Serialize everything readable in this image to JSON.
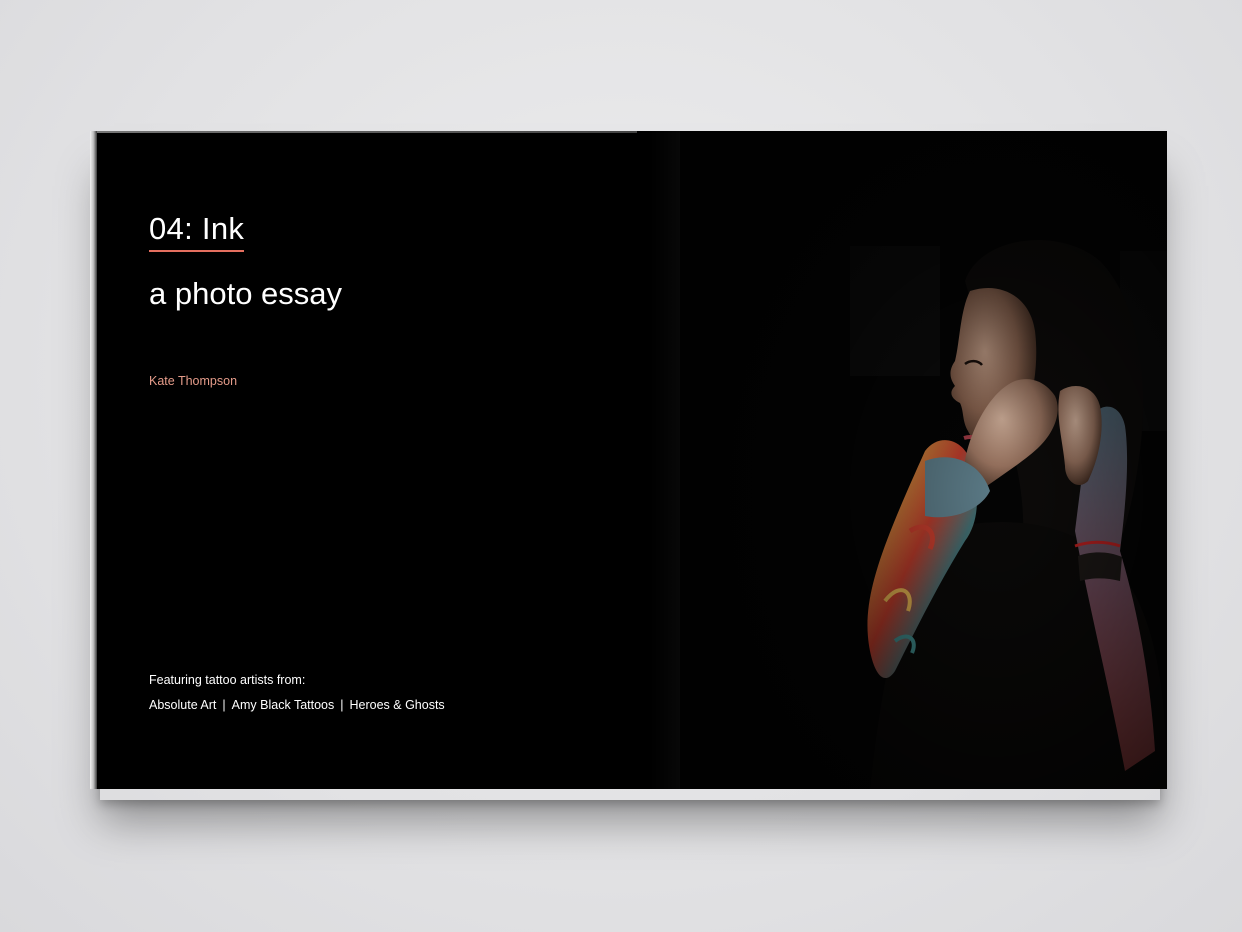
{
  "spread": {
    "chapter_title": "04: Ink",
    "subtitle": "a photo essay",
    "author": "Kate Thompson",
    "featuring_label": "Featuring tattoo artists from:",
    "artists": [
      "Absolute Art",
      "Amy Black Tattoos",
      "Heroes & Ghosts"
    ],
    "separator": "|"
  },
  "colors": {
    "background": "#000000",
    "accent_underline": "#e56f5f",
    "author_text": "#e59c8a",
    "text": "#ffffff"
  },
  "photo": {
    "subject": "tattooed woman looking to the left while adjusting her earring"
  }
}
